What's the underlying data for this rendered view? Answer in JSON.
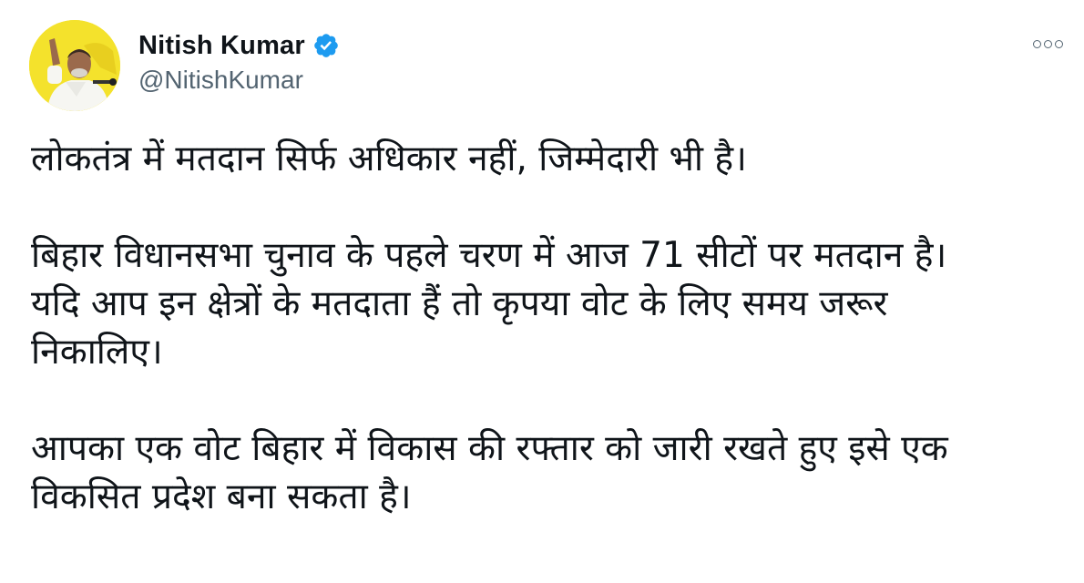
{
  "author": {
    "display_name": "Nitish Kumar",
    "handle": "@NitishKumar",
    "verified": true,
    "avatar_icon": "profile-photo",
    "verified_icon": "verified-badge-icon",
    "verified_color": "#1d9bf0"
  },
  "menu": {
    "icon": "more-options-icon"
  },
  "tweet": {
    "line1": "लोकतंत्र में मतदान सिर्फ अधिकार नहीं, जिम्मेदारी भी है।",
    "line2": "बिहार विधानसभा चुनाव के पहले चरण में आज 71 सीटों पर मतदान है।",
    "line3": "यदि आप इन क्षेत्रों के मतदाता हैं तो कृपया वोट के लिए समय जरूर",
    "line4": "निकालिए।",
    "line5": "आपका एक वोट बिहार में विकास की रफ्तार को जारी रखते हुए इसे एक",
    "line6": "विकसित प्रदेश बना सकता है।"
  }
}
